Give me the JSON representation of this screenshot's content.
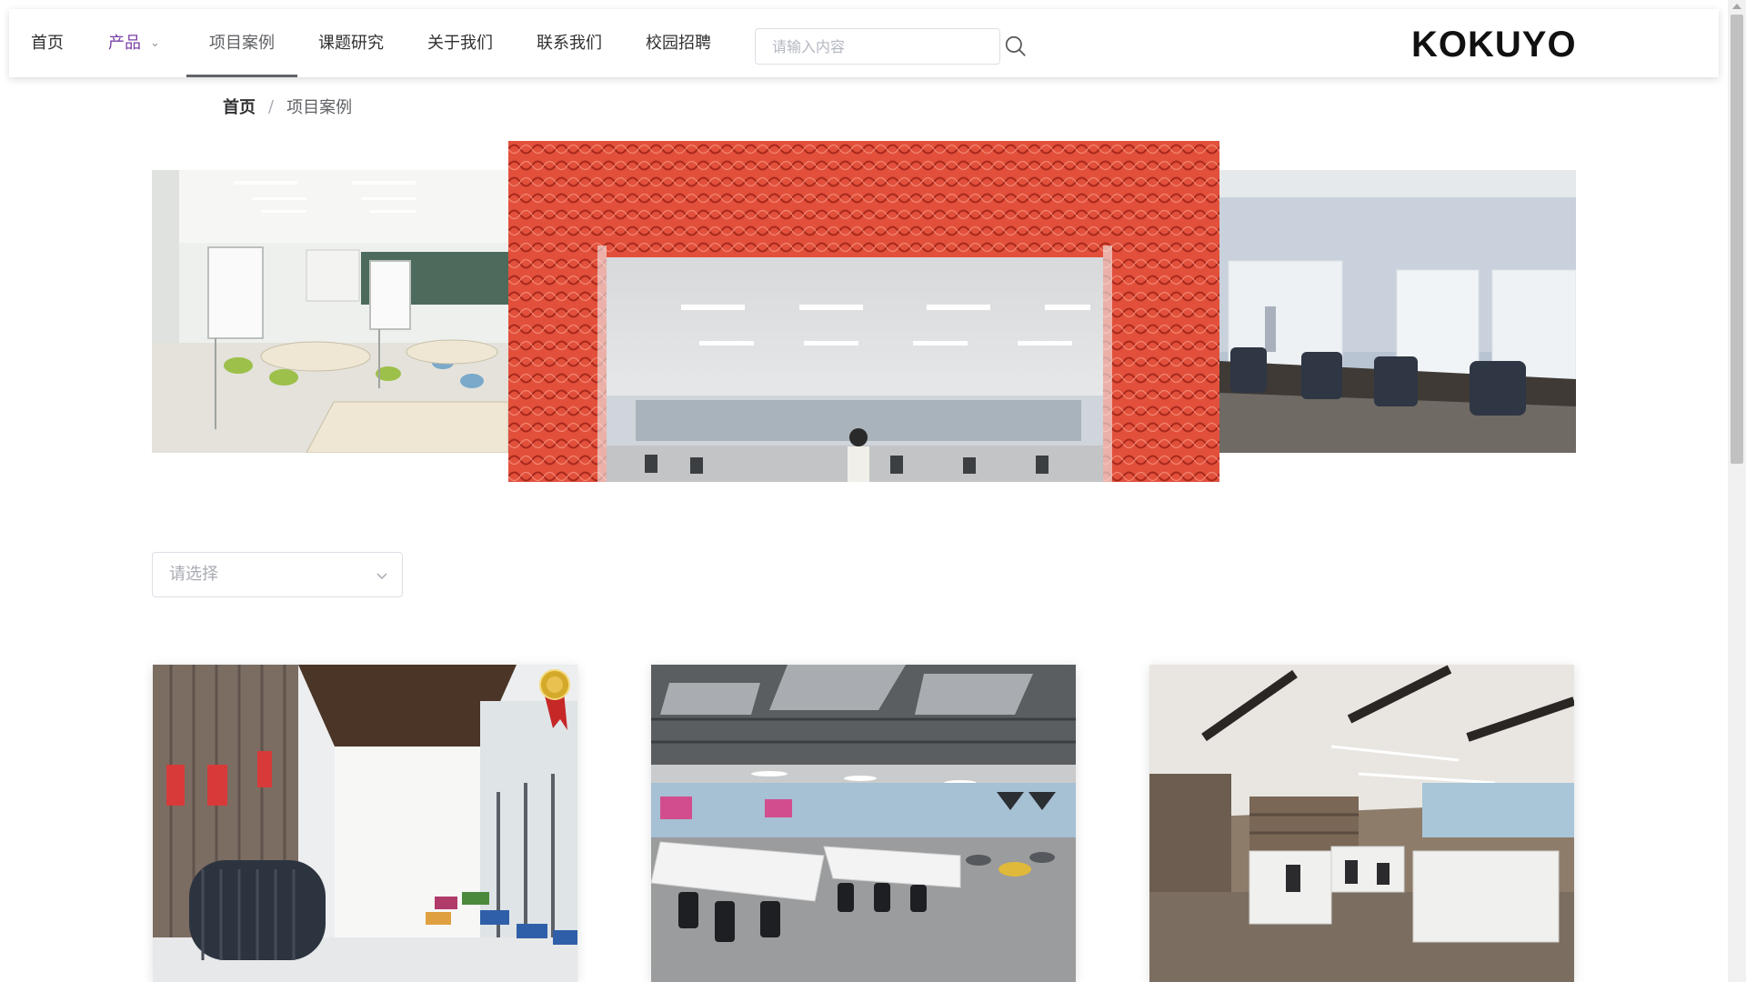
{
  "nav": {
    "items": [
      {
        "label": "首页"
      },
      {
        "label": "产品"
      },
      {
        "label": "项目案例"
      },
      {
        "label": "课题研究"
      },
      {
        "label": "关于我们"
      },
      {
        "label": "联系我们"
      },
      {
        "label": "校园招聘"
      }
    ],
    "search_placeholder": "请输入内容",
    "brand": "KOKUYO"
  },
  "breadcrumb": {
    "home": "首页",
    "separator": "/",
    "current": "项目案例"
  },
  "filter": {
    "placeholder": "请选择"
  },
  "colors": {
    "accent_purple": "#7a3fa6",
    "hero_red": "#d8412f",
    "text_primary": "#303133",
    "text_placeholder": "#a8abb2"
  },
  "icons": {
    "search": "search-icon",
    "dropdown": "chevron-down-icon",
    "award": "award-ribbon-icon"
  }
}
